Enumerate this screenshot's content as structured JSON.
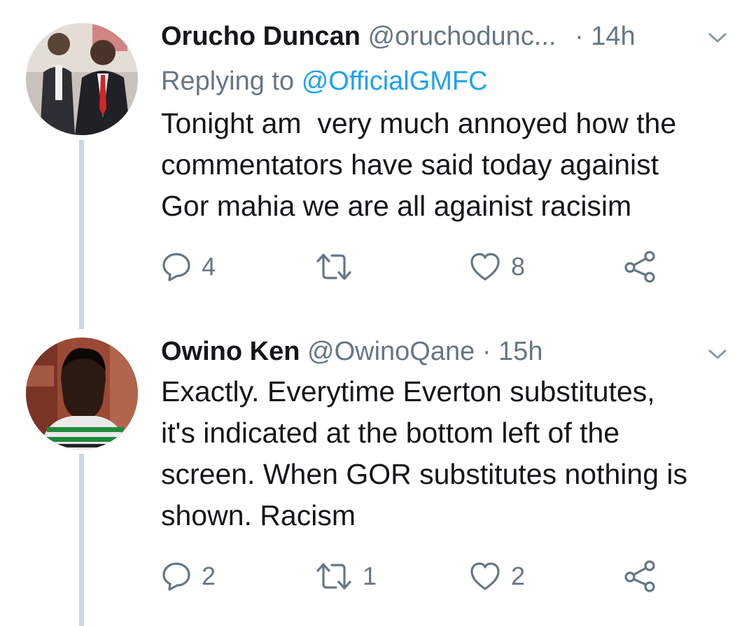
{
  "colors": {
    "text": "#14171a",
    "secondary": "#657786",
    "link": "#1da1f2",
    "thread_line": "#ccd6dd"
  },
  "tweets": [
    {
      "name": "Orucho Duncan",
      "handle": "@oruchodunc...",
      "dot": "·",
      "time": "14h",
      "reply_prefix": "Replying to",
      "reply_mention": "@OfficialGMFC",
      "lines": [
        "Tonight am  very much annoyed how the",
        "commentators have said today againist",
        "Gor mahia we are all againist racisim"
      ],
      "reply_count": "4",
      "retweet_count": "",
      "like_count": "8",
      "icons": [
        "avatar",
        "chevron-down-icon",
        "reply-icon",
        "retweet-icon",
        "like-icon",
        "share-icon"
      ]
    },
    {
      "name": "Owino Ken",
      "handle": "@OwinoQane",
      "dot": "·",
      "time": "15h",
      "lines": [
        "Exactly. Everytime Everton substitutes,",
        "it's indicated at the bottom left of the",
        "screen. When GOR substitutes nothing is",
        "shown. Racism"
      ],
      "reply_count": "2",
      "retweet_count": "1",
      "like_count": "2",
      "icons": [
        "avatar",
        "chevron-down-icon",
        "reply-icon",
        "retweet-icon",
        "like-icon",
        "share-icon"
      ]
    }
  ]
}
